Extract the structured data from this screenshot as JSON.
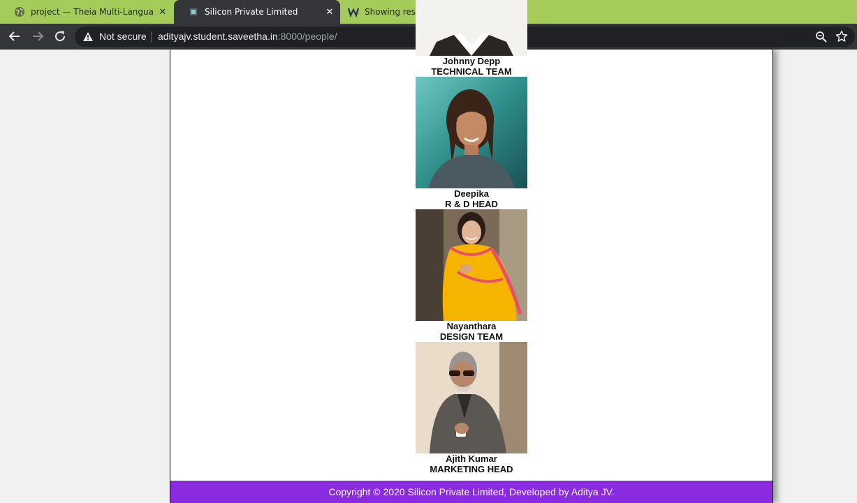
{
  "browser": {
    "tabs": [
      {
        "title": "project — Theia Multi-Language",
        "active": false
      },
      {
        "title": "Silicon Private Limited",
        "active": true
      },
      {
        "title": "Showing results for contents of t",
        "active": false
      }
    ],
    "address_bar": {
      "security_label": "Not secure",
      "host": "adityajv.student.saveetha.in",
      "path": ":8000/people/"
    }
  },
  "people": [
    {
      "name": "Johnny Depp",
      "role": "TECHNICAL TEAM"
    },
    {
      "name": "Deepika",
      "role": "R & D HEAD"
    },
    {
      "name": "Nayanthara",
      "role": "DESIGN TEAM"
    },
    {
      "name": "Ajith Kumar",
      "role": "MARKETING HEAD"
    }
  ],
  "footer": {
    "text": "Copyright © 2020 Silicon Private Limited, Developed by Aditya JV."
  },
  "colors": {
    "tab_strip": "#a5cc5a",
    "toolbar": "#35363a",
    "footer": "#8a2be2"
  }
}
